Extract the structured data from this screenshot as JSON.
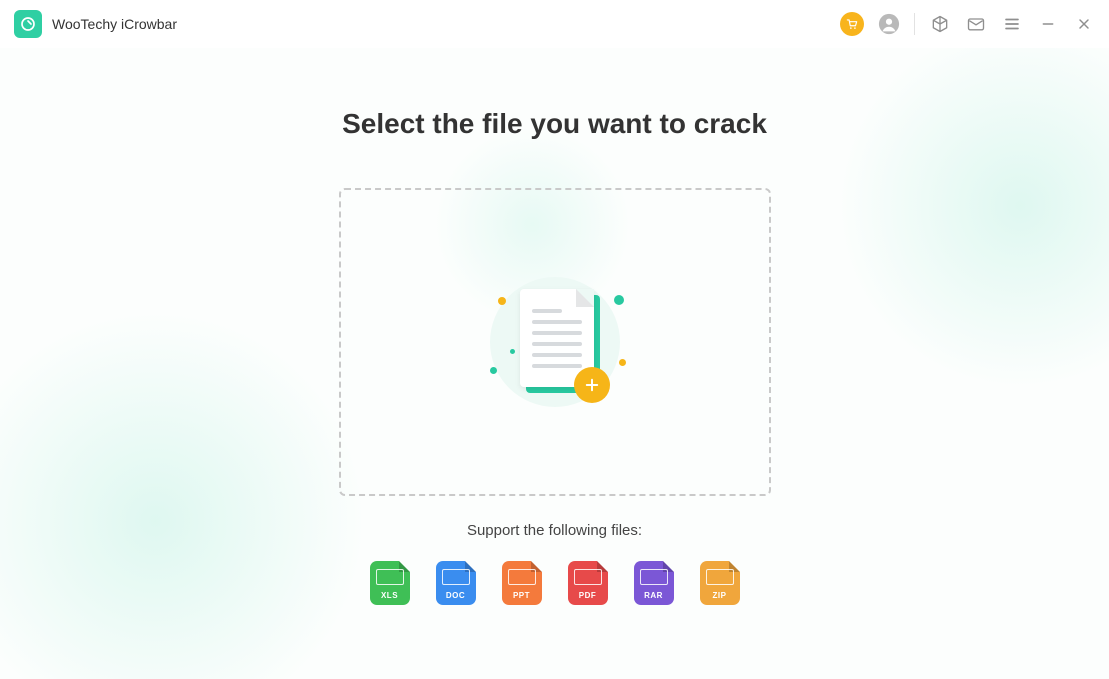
{
  "app": {
    "title": "WooTechy iCrowbar"
  },
  "main": {
    "headline": "Select the file you want to crack",
    "supportText": "Support the following files:"
  },
  "fileTypes": [
    {
      "label": "XLS",
      "class": "xls"
    },
    {
      "label": "DOC",
      "class": "doc"
    },
    {
      "label": "PPT",
      "class": "ppt"
    },
    {
      "label": "PDF",
      "class": "pdf"
    },
    {
      "label": "RAR",
      "class": "rar"
    },
    {
      "label": "ZIP",
      "class": "zip"
    }
  ],
  "icons": {
    "cart": "cart-icon",
    "account": "account-icon",
    "cube": "cube-icon",
    "mail": "mail-icon",
    "menu": "menu-icon",
    "minimize": "minimize-icon",
    "close": "close-icon"
  }
}
